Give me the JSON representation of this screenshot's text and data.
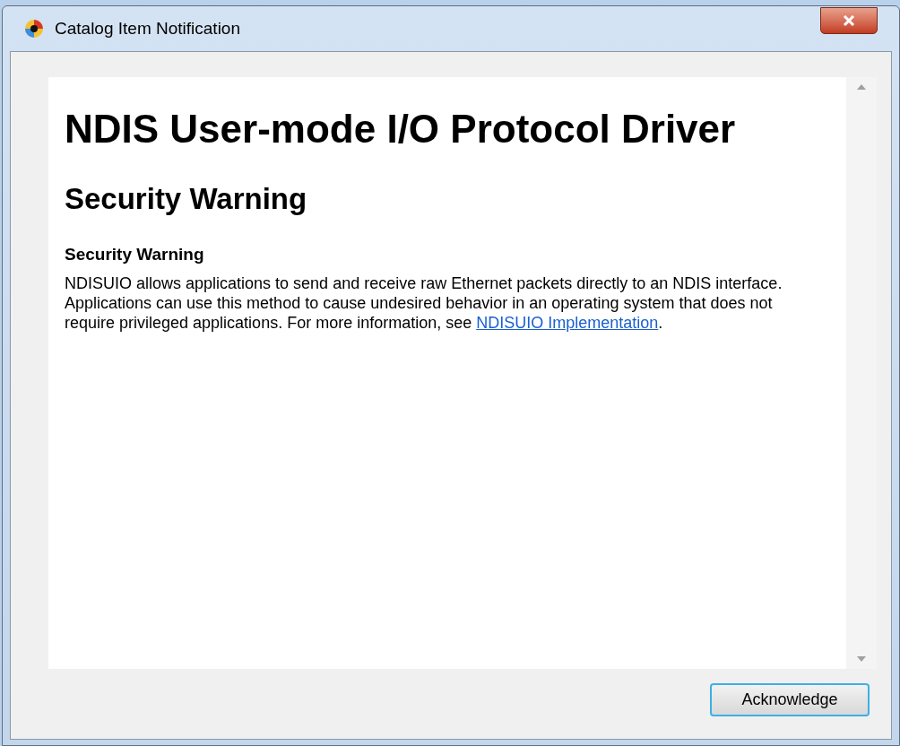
{
  "window": {
    "title": "Catalog Item Notification"
  },
  "content": {
    "heading": "NDIS User-mode I/O Protocol Driver",
    "subheading": "Security Warning",
    "section_title": "Security Warning",
    "paragraph": {
      "text_before": "NDISUIO allows applications to send and receive raw Ethernet packets directly to an NDIS interface. Applications can use this method to cause undesired behavior in an operating system that does not require privileged applications. For more information, see ",
      "link": "NDISUIO Implementation",
      "text_after": "."
    }
  },
  "buttons": [
    {
      "label": "Acknowledge",
      "selected": true
    }
  ]
}
